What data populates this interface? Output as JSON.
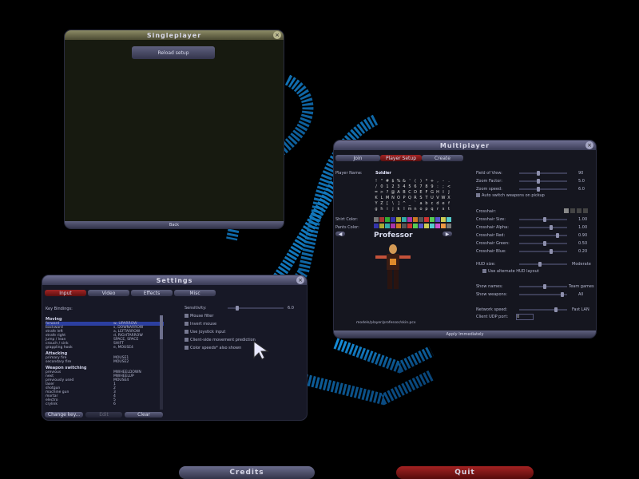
{
  "singleplayer": {
    "title": "Singleplayer",
    "load_button": "Reload setup",
    "back_button": "Back",
    "close_icon": "close-icon"
  },
  "multiplayer": {
    "title": "Multiplayer",
    "tabs": [
      "Join",
      "Player Setup",
      "Create"
    ],
    "player_name_label": "Player Name:",
    "player_name_value": "Soldier",
    "shirt_color_label": "Shirt Color:",
    "pants_color_label": "Pants Color:",
    "model_name": "Professor",
    "model_path": "models/player/professor/skin.pcx",
    "apply_button": "Apply Immediately",
    "right_settings": [
      {
        "label": "Field of View:",
        "value": "90"
      },
      {
        "label": "Zoom Factor:",
        "value": "5.0"
      },
      {
        "label": "Zoom speed:",
        "value": "6.0"
      }
    ],
    "auto_switch": "Auto switch weapons on pickup",
    "crosshair_label": "Crosshair:",
    "crosshair_settings": [
      {
        "label": "Crosshair Size:",
        "value": "1.00"
      },
      {
        "label": "Crosshair Alpha:",
        "value": "1.00"
      },
      {
        "label": "Crosshair Red:",
        "value": "0.90"
      },
      {
        "label": "Crosshair Green:",
        "value": "0.50"
      },
      {
        "label": "Crosshair Blue:",
        "value": "0.20"
      }
    ],
    "hud_label": "HUD size:",
    "hud_value": "Moderate",
    "alt_hud": "Use alternate HUD layout",
    "show_names_label": "Show names:",
    "show_names_value": "Team games",
    "show_weapons_label": "Show weapons:",
    "show_weapons_value": "All",
    "network_label": "Network speed:",
    "network_value": "Fast LAN",
    "udp_label": "Client UDP port:",
    "udp_value": "0"
  },
  "settings": {
    "title": "Settings",
    "tabs": [
      "Input",
      "Video",
      "Effects",
      "Misc"
    ],
    "key_bindings_label": "Key Bindings:",
    "groups": [
      {
        "name": "Moving",
        "rows": [
          {
            "action": "forward",
            "key": "w, UPARROW",
            "selected": true
          },
          {
            "action": "backward",
            "key": "s, DOWNARROW"
          },
          {
            "action": "strafe left",
            "key": "a, LEFTARROW"
          },
          {
            "action": "strafe right",
            "key": "d, RIGHTARROW"
          },
          {
            "action": "jump / lean",
            "key": "SPACE, SPACE"
          },
          {
            "action": "crouch / sink",
            "key": "SHIFT"
          },
          {
            "action": "grappling hook",
            "key": "e, MOUSE4"
          }
        ]
      },
      {
        "name": "Attacking",
        "rows": [
          {
            "action": "primary fire",
            "key": "MOUSE1"
          },
          {
            "action": "secondary fire",
            "key": "MOUSE2"
          }
        ]
      },
      {
        "name": "Weapon switching",
        "rows": [
          {
            "action": "previous",
            "key": "MWHEELDOWN"
          },
          {
            "action": "next",
            "key": "MWHEELUP"
          },
          {
            "action": "previously used",
            "key": "MOUSE4"
          },
          {
            "action": "laser",
            "key": "1"
          },
          {
            "action": "shotgun",
            "key": "2"
          },
          {
            "action": "machine gun",
            "key": "3"
          },
          {
            "action": "mortar",
            "key": "4"
          },
          {
            "action": "electro",
            "key": "5"
          },
          {
            "action": "crylink",
            "key": "6"
          }
        ]
      }
    ],
    "sensitivity_label": "Sensitivity:",
    "sensitivity_value": "6.0",
    "checkboxes": [
      "Mouse filter",
      "Invert mouse",
      "Use joystick input",
      "Client-side movement prediction",
      "Color speeds* also shown"
    ],
    "buttons": [
      "Change key...",
      "Edit",
      "Clear"
    ]
  },
  "bottom": {
    "credits": "Credits",
    "quit": "Quit"
  },
  "colors": {
    "accent_blue": "#1e8fe0",
    "quit_red": "#a42222",
    "selected_row": "#2c3fa0"
  }
}
